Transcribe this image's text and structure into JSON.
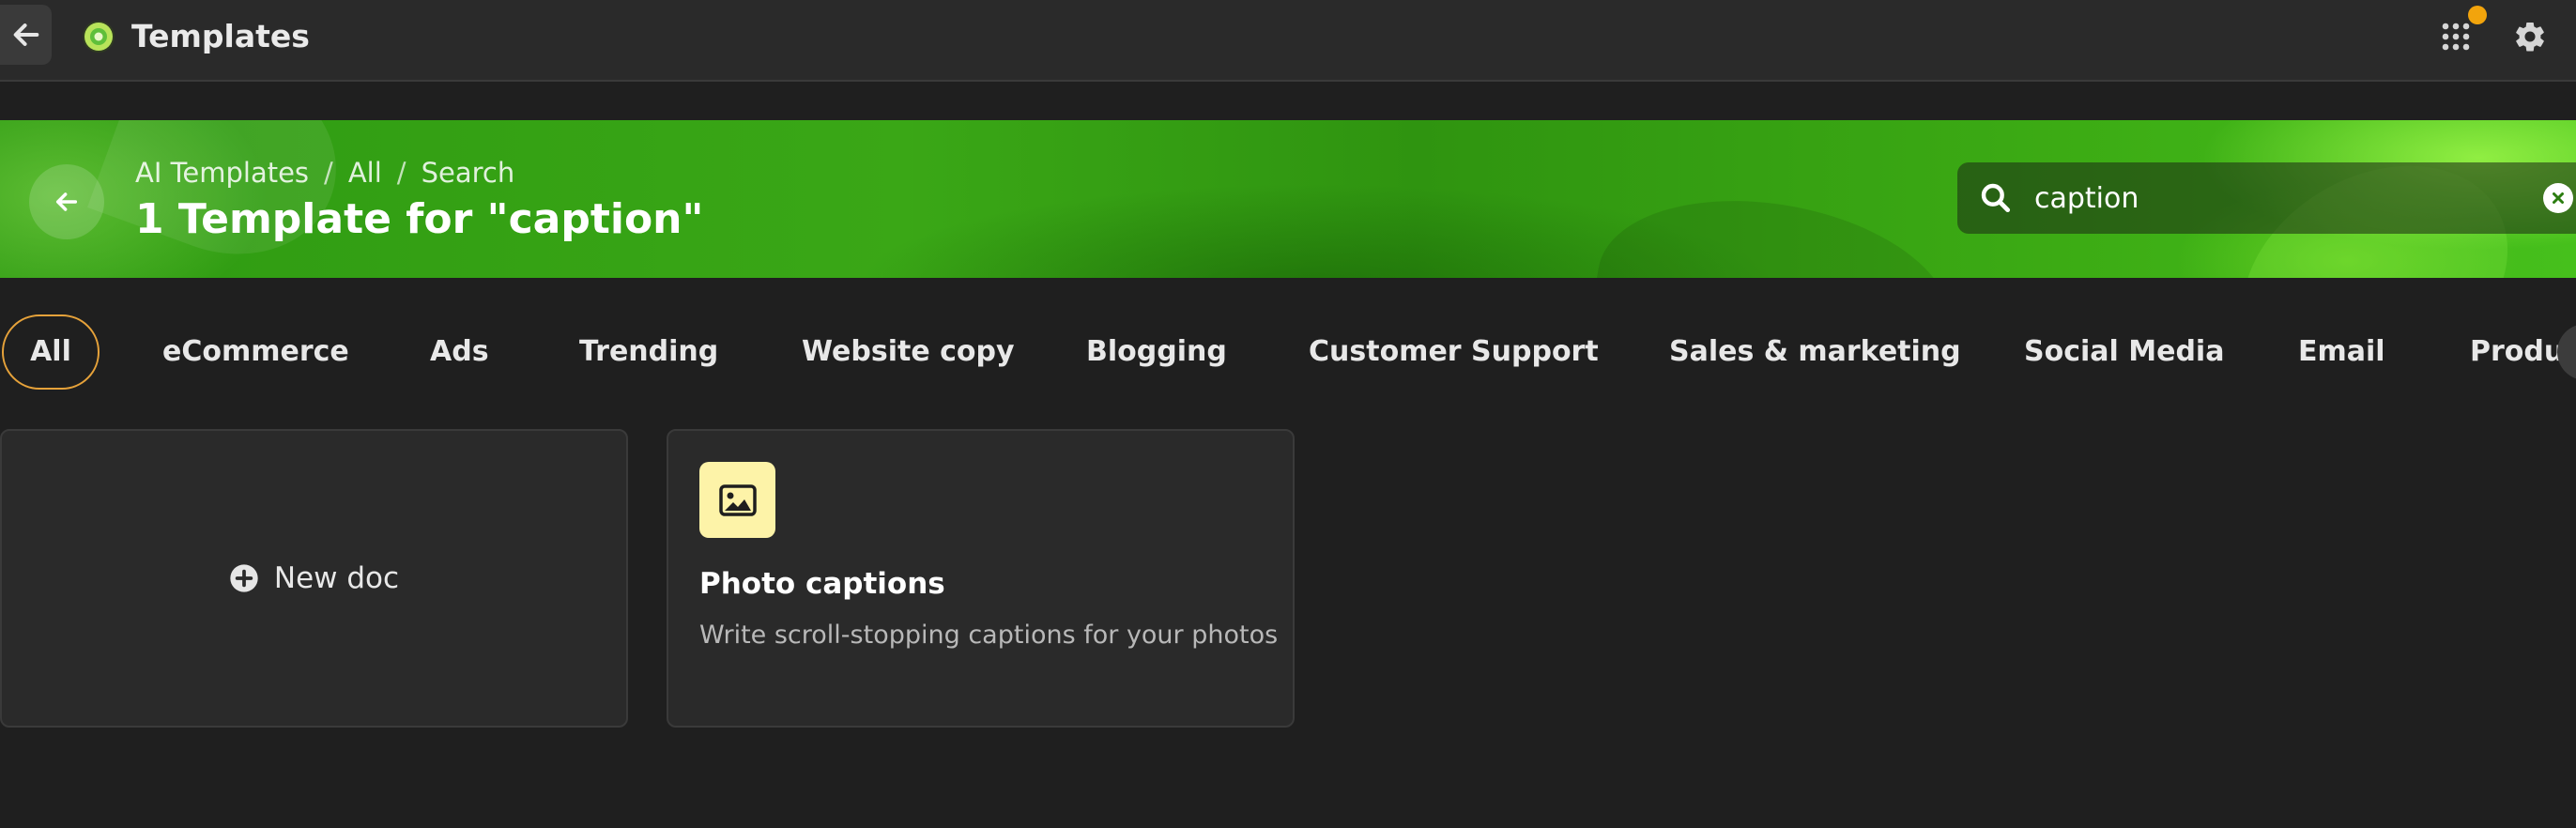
{
  "topbar": {
    "title": "Templates",
    "notification_color": "#f2a40c"
  },
  "banner": {
    "breadcrumb": [
      "AI Templates",
      "All",
      "Search"
    ],
    "breadcrumb_separator": "/",
    "title": "1 Template for \"caption\"",
    "search": {
      "value": "caption"
    }
  },
  "tabs": {
    "items": [
      "All",
      "eCommerce",
      "Ads",
      "Trending",
      "Website copy",
      "Blogging",
      "Customer Support",
      "Sales & marketing",
      "Social Media",
      "Email",
      "Product"
    ],
    "active": "All",
    "active_border_color": "#e6a23a"
  },
  "cards": {
    "new_doc": {
      "label": "New doc"
    },
    "template": {
      "name": "Photo captions",
      "description": "Write scroll-stopping captions for your photos",
      "icon": "image-icon",
      "icon_bg": "#fdf3a8"
    }
  }
}
